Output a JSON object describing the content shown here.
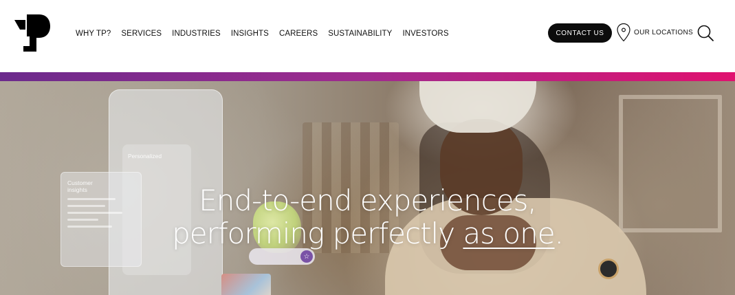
{
  "header": {
    "logo_icon": "tp-logo",
    "nav": [
      {
        "label": "WHY TP?"
      },
      {
        "label": "SERVICES"
      },
      {
        "label": "INDUSTRIES"
      },
      {
        "label": "INSIGHTS"
      },
      {
        "label": "CAREERS"
      },
      {
        "label": "SUSTAINABILITY"
      },
      {
        "label": "INVESTORS"
      }
    ],
    "contact_label": "CONTACT US",
    "locations_label": "OUR LOCATIONS",
    "locations_icon": "map-pin-icon",
    "search_icon": "search-icon"
  },
  "colors": {
    "gradient_start": "#6b2a8c",
    "gradient_end": "#e0116f",
    "button_bg": "#0c0c0c",
    "headline_text": "#ffffff"
  },
  "hero": {
    "headline_line1": "End-to-end experiences,",
    "headline_line2_prefix": "performing perfectly ",
    "headline_line2_accent": "as one",
    "headline_line2_suffix": ".",
    "panel_small_title": "Customer insights",
    "panel_main_title": "Personalized"
  }
}
